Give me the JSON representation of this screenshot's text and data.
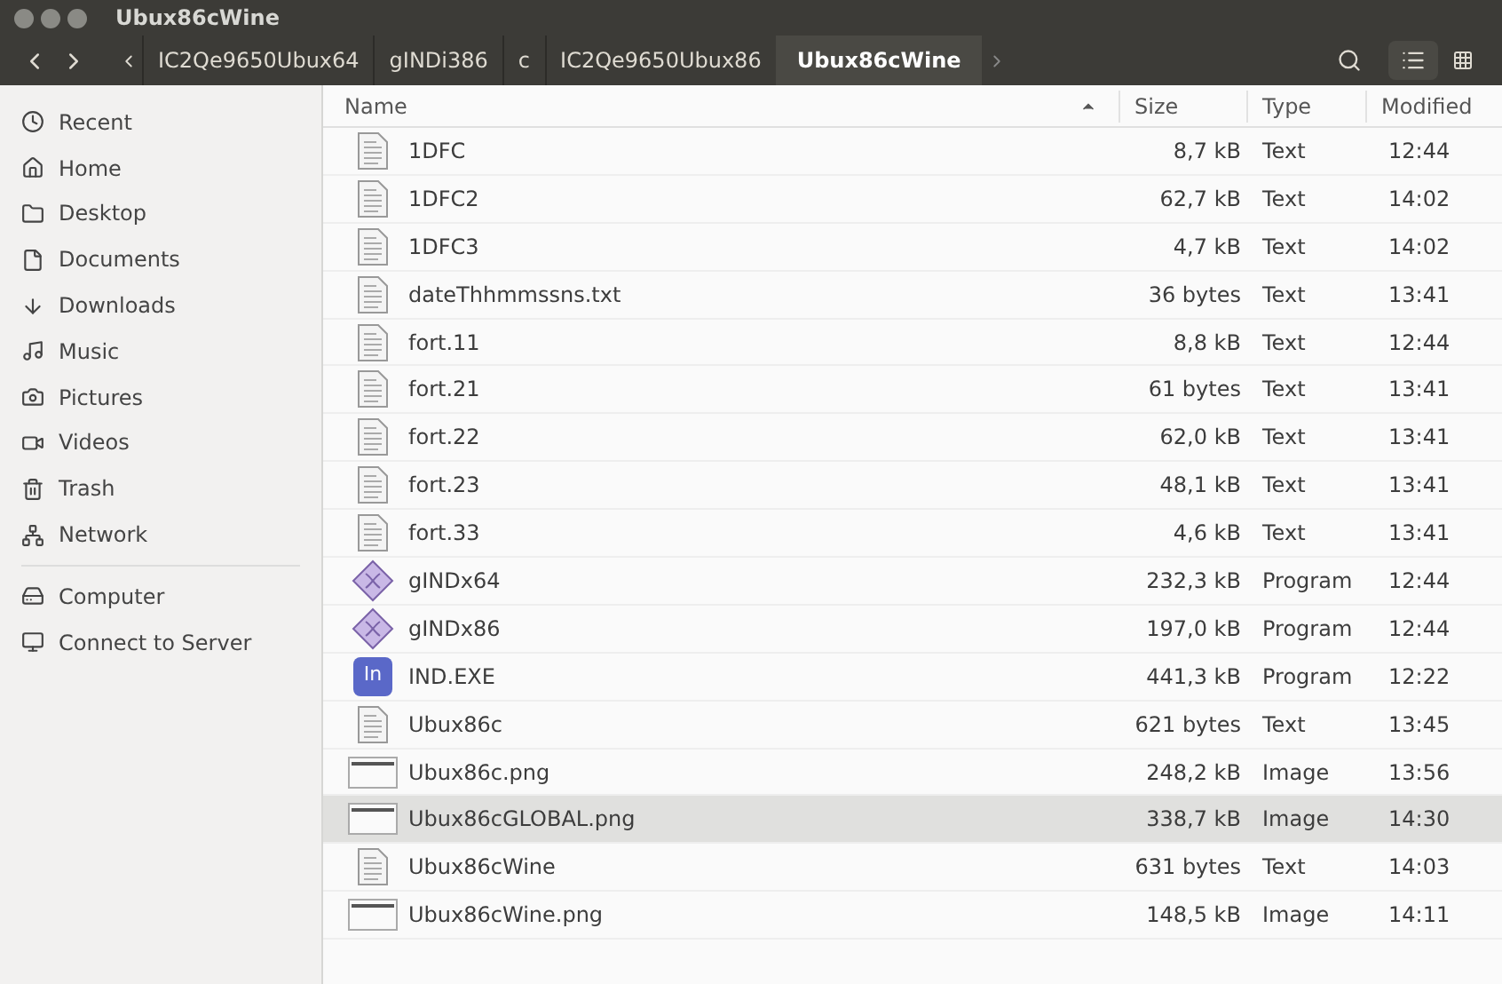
{
  "window": {
    "title": "Ubux86cWine"
  },
  "path": [
    {
      "label": "IC2Qe9650Ubux64",
      "selected": false
    },
    {
      "label": "gINDi386",
      "selected": false
    },
    {
      "label": "c",
      "selected": false
    },
    {
      "label": "IC2Qe9650Ubux86",
      "selected": false
    },
    {
      "label": "Ubux86cWine",
      "selected": true
    }
  ],
  "sidebar": {
    "groups": [
      [
        "Recent",
        "Home",
        "Desktop",
        "Documents",
        "Downloads",
        "Music",
        "Pictures",
        "Videos",
        "Trash",
        "Network"
      ],
      [
        "Computer",
        "Connect to Server"
      ]
    ]
  },
  "table": {
    "columns": [
      "Name",
      "Size",
      "Type",
      "Modified"
    ],
    "rows": [
      {
        "kind": "text",
        "name": "1DFC",
        "size": "8,7 kB",
        "type": "Text",
        "modified": "12:44",
        "selected": false
      },
      {
        "kind": "text",
        "name": "1DFC2",
        "size": "62,7 kB",
        "type": "Text",
        "modified": "14:02",
        "selected": false
      },
      {
        "kind": "text",
        "name": "1DFC3",
        "size": "4,7 kB",
        "type": "Text",
        "modified": "14:02",
        "selected": false
      },
      {
        "kind": "text",
        "name": "dateThhmmssns.txt",
        "size": "36 bytes",
        "type": "Text",
        "modified": "13:41",
        "selected": false
      },
      {
        "kind": "text",
        "name": "fort.11",
        "size": "8,8 kB",
        "type": "Text",
        "modified": "12:44",
        "selected": false
      },
      {
        "kind": "text",
        "name": "fort.21",
        "size": "61 bytes",
        "type": "Text",
        "modified": "13:41",
        "selected": false
      },
      {
        "kind": "text",
        "name": "fort.22",
        "size": "62,0 kB",
        "type": "Text",
        "modified": "13:41",
        "selected": false
      },
      {
        "kind": "text",
        "name": "fort.23",
        "size": "48,1 kB",
        "type": "Text",
        "modified": "13:41",
        "selected": false
      },
      {
        "kind": "text",
        "name": "fort.33",
        "size": "4,6 kB",
        "type": "Text",
        "modified": "13:41",
        "selected": false
      },
      {
        "kind": "program",
        "name": "gINDx64",
        "size": "232,3 kB",
        "type": "Program",
        "modified": "12:44",
        "selected": false
      },
      {
        "kind": "program",
        "name": "gINDx86",
        "size": "197,0 kB",
        "type": "Program",
        "modified": "12:44",
        "selected": false
      },
      {
        "kind": "app",
        "icon_text": "In",
        "name": "IND.EXE",
        "size": "441,3 kB",
        "type": "Program",
        "modified": "12:22",
        "selected": false
      },
      {
        "kind": "text",
        "name": "Ubux86c",
        "size": "621 bytes",
        "type": "Text",
        "modified": "13:45",
        "selected": false
      },
      {
        "kind": "image",
        "name": "Ubux86c.png",
        "size": "248,2 kB",
        "type": "Image",
        "modified": "13:56",
        "selected": false
      },
      {
        "kind": "image",
        "name": "Ubux86cGLOBAL.png",
        "size": "338,7 kB",
        "type": "Image",
        "modified": "14:30",
        "selected": true
      },
      {
        "kind": "text",
        "name": "Ubux86cWine",
        "size": "631 bytes",
        "type": "Text",
        "modified": "14:03",
        "selected": false
      },
      {
        "kind": "image",
        "name": "Ubux86cWine.png",
        "size": "148,5 kB",
        "type": "Image",
        "modified": "14:11",
        "selected": false
      }
    ]
  }
}
